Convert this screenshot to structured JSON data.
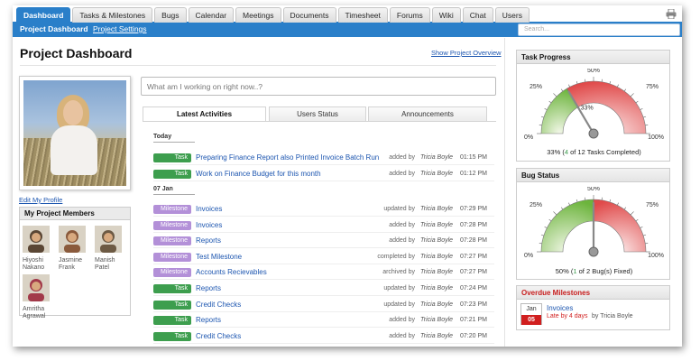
{
  "nav": {
    "tabs": [
      "Dashboard",
      "Tasks & Milestones",
      "Bugs",
      "Calendar",
      "Meetings",
      "Documents",
      "Timesheet",
      "Forums",
      "Wiki",
      "Chat",
      "Users"
    ],
    "active_tab": "Dashboard",
    "subnav": [
      "Project Dashboard",
      "Project Settings"
    ],
    "search_placeholder": "Search..."
  },
  "main": {
    "title": "Project Dashboard",
    "show_overview": "Show Project Overview",
    "edit_profile": "Edit My Profile",
    "working_placeholder": "What am I working on right now..?",
    "activity_tabs": [
      "Latest Activities",
      "Users Status",
      "Announcements"
    ],
    "day_labels": [
      "Today",
      "07 Jan"
    ],
    "activities_today": [
      {
        "type": "Task",
        "name": "Preparing Finance Report also Printed Invoice Batch Run",
        "action": "added by",
        "who": "Tricia Boyle",
        "time": "01:15 PM"
      },
      {
        "type": "Task",
        "name": "Work on Finance Budget for this month",
        "action": "added by",
        "who": "Tricia Boyle",
        "time": "01:12 PM"
      }
    ],
    "activities_jan7": [
      {
        "type": "Milestone",
        "name": "Invoices",
        "action": "updated by",
        "who": "Tricia Boyle",
        "time": "07:29 PM"
      },
      {
        "type": "Milestone",
        "name": "Invoices",
        "action": "added by",
        "who": "Tricia Boyle",
        "time": "07:28 PM"
      },
      {
        "type": "Milestone",
        "name": "Reports",
        "action": "added by",
        "who": "Tricia Boyle",
        "time": "07:28 PM"
      },
      {
        "type": "Milestone",
        "name": "Test Milestone",
        "action": "completed by",
        "who": "Tricia Boyle",
        "time": "07:27 PM"
      },
      {
        "type": "Milestone",
        "name": "Accounts Recievables",
        "action": "archived by",
        "who": "Tricia Boyle",
        "time": "07:27 PM"
      },
      {
        "type": "Task",
        "name": "Reports",
        "action": "updated by",
        "who": "Tricia Boyle",
        "time": "07:24 PM"
      },
      {
        "type": "Task",
        "name": "Credit Checks",
        "action": "updated by",
        "who": "Tricia Boyle",
        "time": "07:23 PM"
      },
      {
        "type": "Task",
        "name": "Reports",
        "action": "added by",
        "who": "Tricia Boyle",
        "time": "07:21 PM"
      },
      {
        "type": "Task",
        "name": "Credit Checks",
        "action": "added by",
        "who": "Tricia Boyle",
        "time": "07:20 PM"
      }
    ]
  },
  "members": {
    "title": "My Project Members",
    "people": [
      {
        "first": "Hiyoshi",
        "last": "Nakano",
        "color": "#5a4634"
      },
      {
        "first": "Jasmine",
        "last": "Frank",
        "color": "#8a5a3c"
      },
      {
        "first": "Manish",
        "last": "Patel",
        "color": "#6d5a44"
      },
      {
        "first": "Amritha",
        "last": "Agrawal",
        "color": "#a23a4a"
      }
    ]
  },
  "task_progress": {
    "title": "Task Progress",
    "ticks": [
      "0%",
      "25%",
      "50%",
      "75%",
      "100%"
    ],
    "needle_label": "33%",
    "percent": 33,
    "caption_pre": "33% (",
    "done": "4",
    "caption_post": " of 12 Tasks Completed)"
  },
  "bug_status": {
    "title": "Bug Status",
    "ticks": [
      "0%",
      "25%",
      "50%",
      "75%",
      "100%"
    ],
    "percent": 50,
    "caption_pre": "50% (",
    "done": "1",
    "caption_post": " of 2 Bug(s) Fixed)"
  },
  "overdue": {
    "title": "Overdue Milestones",
    "month": "Jan",
    "day": "05",
    "name": "Invoices",
    "late": "Late by 4 days",
    "by": "by Tricia Boyle"
  },
  "colors": {
    "accent": "#2a7fc9",
    "task": "#3d9e4e",
    "milestone": "#b390d8",
    "alert": "#d11f1f"
  }
}
